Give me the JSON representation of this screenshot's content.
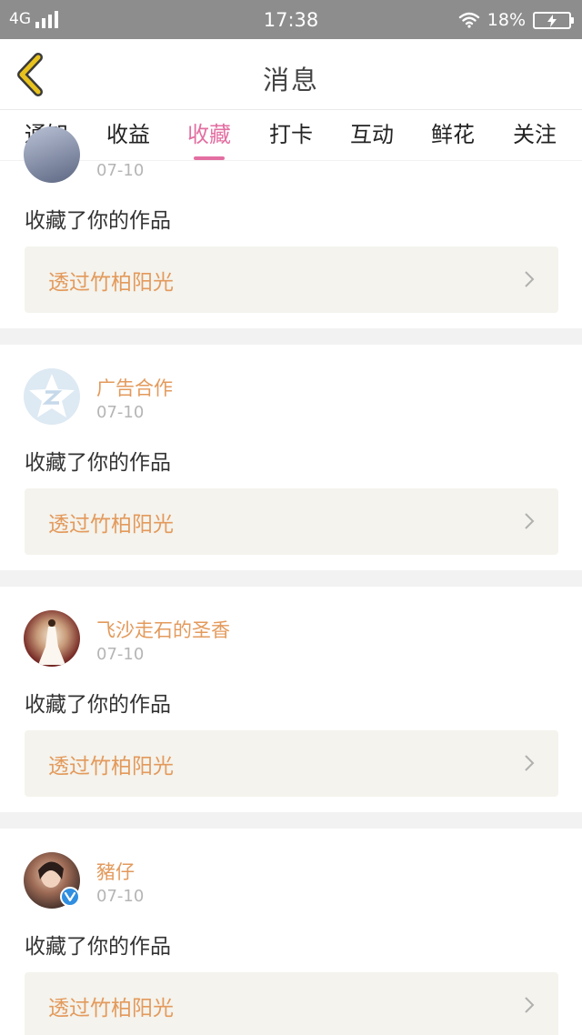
{
  "status_bar": {
    "network": "4G",
    "time": "17:38",
    "battery_percent": "18%"
  },
  "header": {
    "title": "消息"
  },
  "tabs": [
    {
      "label": "通知"
    },
    {
      "label": "收益"
    },
    {
      "label": "收藏",
      "active": true
    },
    {
      "label": "打卡"
    },
    {
      "label": "互动"
    },
    {
      "label": "鲜花"
    },
    {
      "label": "关注"
    }
  ],
  "items": [
    {
      "username": "",
      "date": "07-10",
      "action": "收藏了你的作品",
      "work_title": "透过竹柏阳光"
    },
    {
      "username": "广告合作",
      "date": "07-10",
      "action": "收藏了你的作品",
      "work_title": "透过竹柏阳光"
    },
    {
      "username": "飞沙走石的圣香",
      "date": "07-10",
      "action": "收藏了你的作品",
      "work_title": "透过竹柏阳光"
    },
    {
      "username": "豬仔",
      "date": "07-10",
      "action": "收藏了你的作品",
      "work_title": "透过竹柏阳光",
      "verified": true
    }
  ],
  "colors": {
    "accent": "#e36fa2",
    "username": "#e39a5c",
    "work_bg": "#f4f3ed",
    "back_arrow": "#e8c21d"
  }
}
